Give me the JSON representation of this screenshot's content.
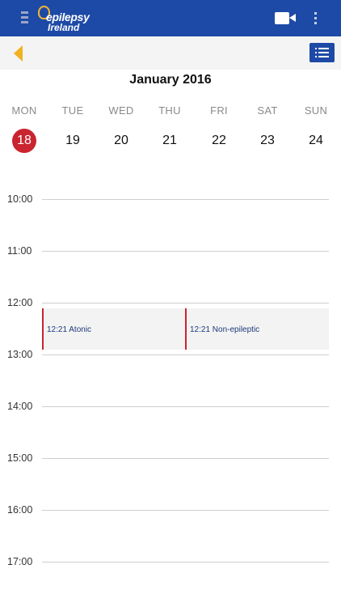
{
  "colors": {
    "appbar": "#1d4aa6",
    "accent_back": "#f0b21f",
    "today": "#c9242f",
    "event_border": "#c9242f",
    "event_text": "#1f3a7a"
  },
  "appbar": {
    "logo_line1": "epilepsy",
    "logo_line2": "Ireland",
    "icons": [
      "menu-icon",
      "video-camera-icon",
      "more-vertical-icon"
    ]
  },
  "toolbar": {
    "icons": [
      "back-arrow-icon",
      "list-view-icon"
    ]
  },
  "calendar": {
    "month_title": "January 2016",
    "weekdays": [
      "MON",
      "TUE",
      "WED",
      "THU",
      "FRI",
      "SAT",
      "SUN"
    ],
    "dates": [
      "18",
      "19",
      "20",
      "21",
      "22",
      "23",
      "24"
    ],
    "today_index": 0
  },
  "timeline": {
    "hours": [
      "10:00",
      "11:00",
      "12:00",
      "13:00",
      "14:00",
      "15:00",
      "16:00",
      "17:00"
    ],
    "events": [
      {
        "label": "12:21 Atonic",
        "column": 0
      },
      {
        "label": "12:21 Non-epileptic",
        "column": 1
      }
    ]
  }
}
